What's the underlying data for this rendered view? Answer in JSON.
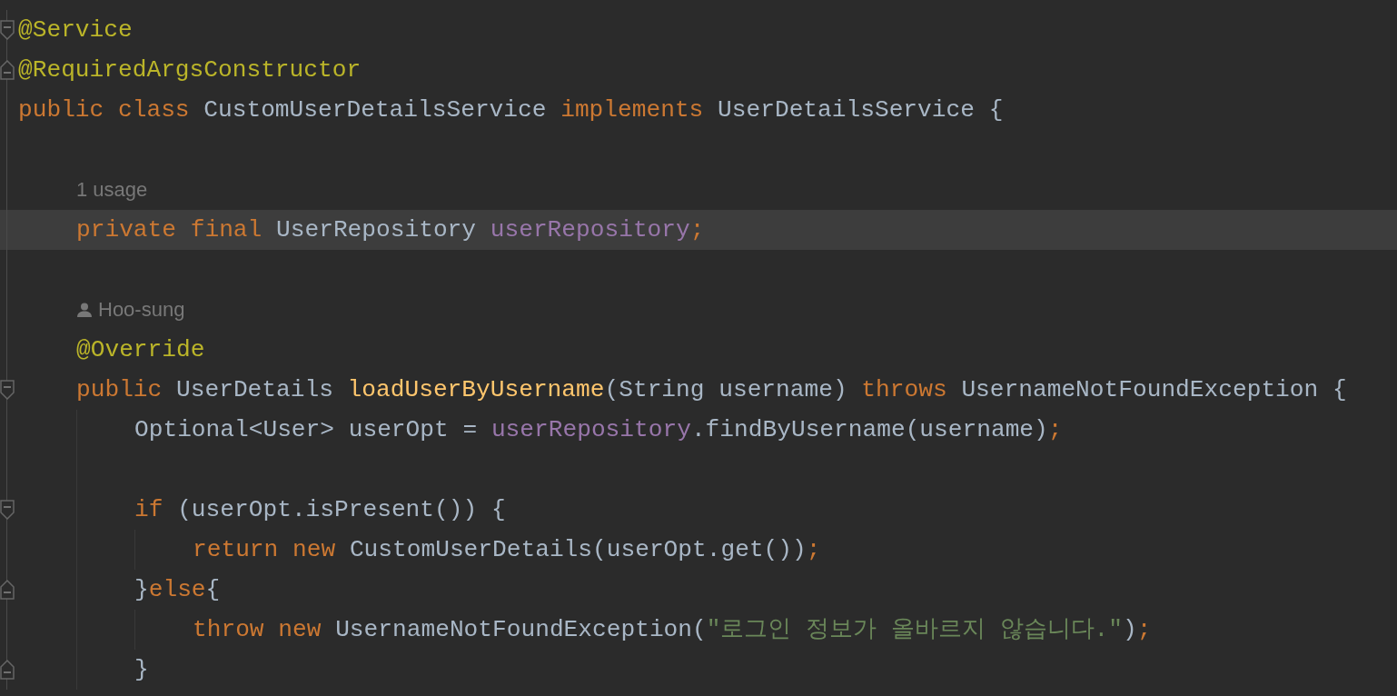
{
  "editor": {
    "lines": [
      {
        "kind": "code",
        "fold_open": true,
        "fold_close": false,
        "current": false,
        "tokens": [
          {
            "text": "@Service",
            "kind": "annotation"
          }
        ]
      },
      {
        "kind": "code",
        "fold_open": false,
        "fold_close": true,
        "current": false,
        "tokens": [
          {
            "text": "@RequiredArgsConstructor",
            "kind": "annotation"
          }
        ]
      },
      {
        "kind": "code",
        "fold_open": false,
        "fold_close": false,
        "current": false,
        "tokens": [
          {
            "text": "public class ",
            "kind": "keyword"
          },
          {
            "text": "CustomUserDetailsService ",
            "kind": "plain"
          },
          {
            "text": "implements ",
            "kind": "keyword"
          },
          {
            "text": "UserDetailsService {",
            "kind": "plain"
          }
        ],
        "children": [
          {
            "kind": "blank",
            "fold_open": false,
            "fold_close": false,
            "current": false
          },
          {
            "kind": "hint",
            "fold_open": false,
            "fold_close": false,
            "current": false,
            "text": "1 usage"
          },
          {
            "kind": "code",
            "fold_open": false,
            "fold_close": false,
            "current": true,
            "tokens": [
              {
                "text": "private final ",
                "kind": "keyword"
              },
              {
                "text": "UserRepository ",
                "kind": "plain"
              },
              {
                "text": "userRepository",
                "kind": "field"
              },
              {
                "text": ";",
                "kind": "punct"
              }
            ]
          },
          {
            "kind": "blank",
            "fold_open": false,
            "fold_close": false,
            "current": false
          },
          {
            "kind": "author",
            "fold_open": false,
            "fold_close": false,
            "current": false,
            "text": "Hoo-sung"
          },
          {
            "kind": "code",
            "fold_open": false,
            "fold_close": false,
            "current": false,
            "tokens": [
              {
                "text": "@Override",
                "kind": "annotation"
              }
            ]
          },
          {
            "kind": "code",
            "fold_open": true,
            "fold_close": false,
            "current": false,
            "tokens": [
              {
                "text": "public ",
                "kind": "keyword"
              },
              {
                "text": "UserDetails ",
                "kind": "plain"
              },
              {
                "text": "loadUserByUsername",
                "kind": "method"
              },
              {
                "text": "(String username) ",
                "kind": "plain"
              },
              {
                "text": "throws ",
                "kind": "keyword"
              },
              {
                "text": "UsernameNotFoundException {",
                "kind": "plain"
              }
            ],
            "children": [
              {
                "kind": "code",
                "fold_open": false,
                "fold_close": false,
                "current": false,
                "tokens": [
                  {
                    "text": "Optional<User> userOpt = ",
                    "kind": "plain"
                  },
                  {
                    "text": "userRepository",
                    "kind": "field"
                  },
                  {
                    "text": ".findByUsername(username)",
                    "kind": "plain"
                  },
                  {
                    "text": ";",
                    "kind": "punct"
                  }
                ]
              },
              {
                "kind": "blank",
                "fold_open": false,
                "fold_close": false,
                "current": false
              },
              {
                "kind": "code",
                "fold_open": true,
                "fold_close": false,
                "current": false,
                "tokens": [
                  {
                    "text": "if ",
                    "kind": "keyword"
                  },
                  {
                    "text": "(userOpt.isPresent()) {",
                    "kind": "plain"
                  }
                ],
                "children": [
                  {
                    "kind": "code",
                    "fold_open": false,
                    "fold_close": false,
                    "current": false,
                    "tokens": [
                      {
                        "text": "return new ",
                        "kind": "keyword"
                      },
                      {
                        "text": "CustomUserDetails(userOpt.get())",
                        "kind": "plain"
                      },
                      {
                        "text": ";",
                        "kind": "punct"
                      }
                    ]
                  }
                ]
              },
              {
                "kind": "code",
                "fold_open": false,
                "fold_close": true,
                "current": false,
                "tokens": [
                  {
                    "text": "}",
                    "kind": "plain"
                  },
                  {
                    "text": "else",
                    "kind": "keyword"
                  },
                  {
                    "text": "{",
                    "kind": "plain"
                  }
                ],
                "children": [
                  {
                    "kind": "code",
                    "fold_open": false,
                    "fold_close": false,
                    "current": false,
                    "tokens": [
                      {
                        "text": "throw new ",
                        "kind": "keyword"
                      },
                      {
                        "text": "UsernameNotFoundException(",
                        "kind": "plain"
                      },
                      {
                        "text": "\"로그인 정보가 올바르지 않습니다.\"",
                        "kind": "string"
                      },
                      {
                        "text": ")",
                        "kind": "plain"
                      },
                      {
                        "text": ";",
                        "kind": "punct"
                      }
                    ]
                  }
                ]
              },
              {
                "kind": "code",
                "fold_open": false,
                "fold_close": true,
                "current": false,
                "tokens": [
                  {
                    "text": "}",
                    "kind": "plain"
                  }
                ]
              }
            ]
          }
        ]
      }
    ]
  }
}
